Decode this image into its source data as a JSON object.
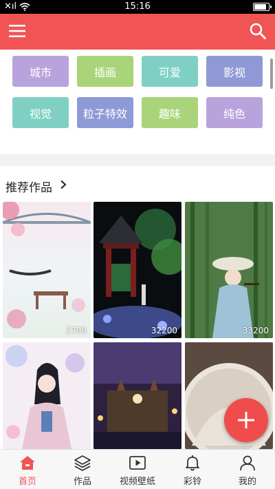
{
  "status_bar": {
    "time": "15:16",
    "signal_label": "✕ıl",
    "battery_level": 0.9
  },
  "app_bar": {
    "menu_icon": "menu-icon",
    "search_icon": "search-icon",
    "color": "#f05455"
  },
  "categories": [
    {
      "label": "城市",
      "color": "#b9a3dd"
    },
    {
      "label": "插画",
      "color": "#a9d47a"
    },
    {
      "label": "可爱",
      "color": "#7fd0c3"
    },
    {
      "label": "影视",
      "color": "#8f99d6"
    },
    {
      "label": "视觉",
      "color": "#7fd0c3"
    },
    {
      "label": "粒子特效",
      "color": "#8f99d6"
    },
    {
      "label": "趣味",
      "color": "#a9d47a"
    },
    {
      "label": "纯色",
      "color": "#b9a3dd"
    }
  ],
  "recommended": {
    "title": "推荐作品",
    "items": [
      {
        "count": "2700"
      },
      {
        "count": "32200"
      },
      {
        "count": "33200"
      }
    ]
  },
  "fab": {
    "icon": "plus-icon"
  },
  "bottom_nav": {
    "items": [
      {
        "label": "首页",
        "icon": "home-icon",
        "active": true
      },
      {
        "label": "作品",
        "icon": "layers-icon",
        "active": false
      },
      {
        "label": "视频壁纸",
        "icon": "video-icon",
        "active": false
      },
      {
        "label": "彩铃",
        "icon": "bell-icon",
        "active": false
      },
      {
        "label": "我的",
        "icon": "user-icon",
        "active": false
      }
    ]
  }
}
